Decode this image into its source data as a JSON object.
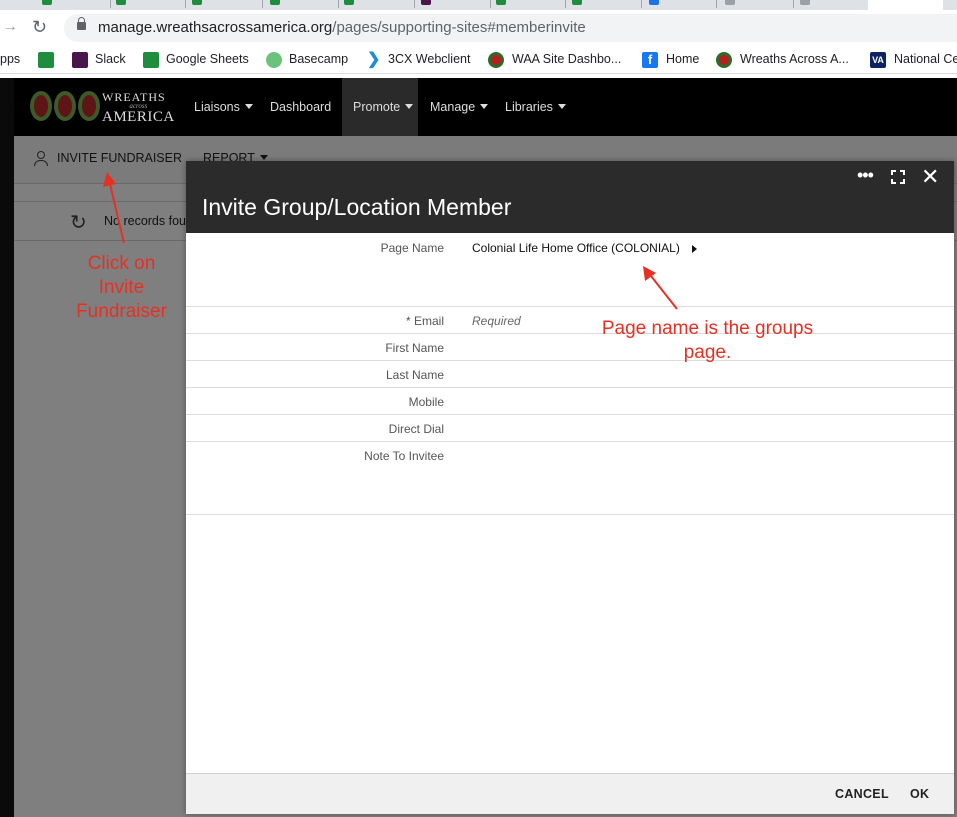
{
  "browser": {
    "url_host": "manage.wreathsacrossamerica.org",
    "url_path": "/pages/supporting-sites#memberinvite",
    "bookmarks": [
      {
        "label": "pps",
        "icon": "apps-icon"
      },
      {
        "label": "",
        "icon": "google-sheets-icon"
      },
      {
        "label": "Slack",
        "icon": "slack-icon"
      },
      {
        "label": "Google Sheets",
        "icon": "google-sheets-icon"
      },
      {
        "label": "Basecamp",
        "icon": "basecamp-icon"
      },
      {
        "label": "3CX Webclient",
        "icon": "3cx-icon"
      },
      {
        "label": "WAA Site Dashbo...",
        "icon": "waa-icon"
      },
      {
        "label": "Home",
        "icon": "facebook-icon"
      },
      {
        "label": "Wreaths Across A...",
        "icon": "waa-icon"
      },
      {
        "label": "National Ce",
        "icon": "va-icon",
        "icon_text": "VA"
      }
    ]
  },
  "app": {
    "logo": {
      "line1": "WREATHS",
      "line2": "across",
      "line3": "AMERICA"
    },
    "nav": [
      {
        "label": "Liaisons",
        "dropdown": true
      },
      {
        "label": "Dashboard",
        "dropdown": false
      },
      {
        "label": "Promote",
        "dropdown": true
      },
      {
        "label": "Manage",
        "dropdown": true
      },
      {
        "label": "Libraries",
        "dropdown": true
      }
    ],
    "toolbar": {
      "invite_label": "INVITE FUNDRAISER",
      "report_label": "REPORT"
    },
    "no_records": "No records fou"
  },
  "annotations": {
    "left": "Click on Invite Fundraiser",
    "right": "Page name is the groups page.",
    "color": "#e53124"
  },
  "dialog": {
    "title": "Invite Group/Location Member",
    "fields": {
      "page_name": {
        "label": "Page Name",
        "value": "Colonial Life Home Office  (COLONIAL)"
      },
      "email": {
        "label": "* Email",
        "placeholder": "Required"
      },
      "first_name": {
        "label": "First Name"
      },
      "last_name": {
        "label": "Last Name"
      },
      "mobile": {
        "label": "Mobile"
      },
      "direct_dial": {
        "label": "Direct Dial"
      },
      "note": {
        "label": "Note To Invitee"
      }
    },
    "cancel_label": "CANCEL",
    "ok_label": "OK"
  }
}
